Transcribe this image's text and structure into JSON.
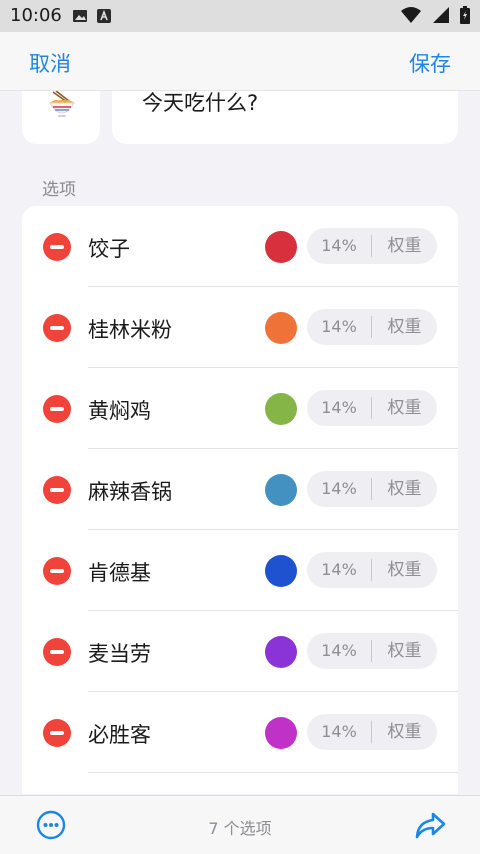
{
  "status_bar": {
    "time": "10:06",
    "icons_left": [
      "image-icon",
      "text-a-icon"
    ],
    "icons_right": [
      "wifi-icon",
      "signal-icon",
      "battery-icon"
    ]
  },
  "nav": {
    "cancel_label": "取消",
    "save_label": "保存"
  },
  "wheel": {
    "emoji": "noodle-bowl-icon",
    "title": "今天吃什么?"
  },
  "options_section": {
    "label": "选项",
    "items": [
      {
        "name": "饺子",
        "color": "#d9303d",
        "percent": "14%",
        "weight_placeholder": "权重"
      },
      {
        "name": "桂林米粉",
        "color": "#ef7238",
        "percent": "14%",
        "weight_placeholder": "权重"
      },
      {
        "name": "黄焖鸡",
        "color": "#85b547",
        "percent": "14%",
        "weight_placeholder": "权重"
      },
      {
        "name": "麻辣香锅",
        "color": "#4291c0",
        "percent": "14%",
        "weight_placeholder": "权重"
      },
      {
        "name": "肯德基",
        "color": "#1f52cf",
        "percent": "14%",
        "weight_placeholder": "权重"
      },
      {
        "name": "麦当劳",
        "color": "#8a34d8",
        "percent": "14%",
        "weight_placeholder": "权重"
      },
      {
        "name": "必胜客",
        "color": "#c031c7",
        "percent": "14%",
        "weight_placeholder": "权重"
      }
    ]
  },
  "toolbar": {
    "count_label": "7 个选项",
    "more_icon": "more-circle-icon",
    "share_icon": "share-arrow-icon",
    "accent": "#1a86e8"
  }
}
